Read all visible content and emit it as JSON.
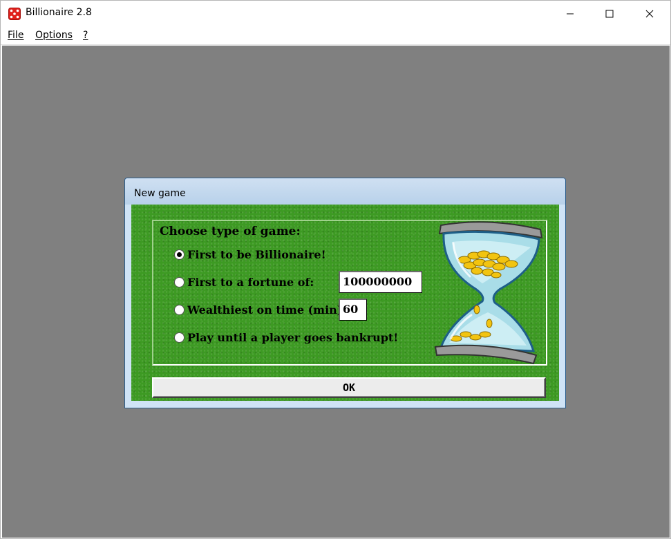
{
  "window": {
    "title": "Billionaire 2.8",
    "icon": "red-dice-icon",
    "controls": [
      "minimize-icon",
      "maximize-icon",
      "close-icon"
    ]
  },
  "menu": {
    "items": [
      {
        "label": "File"
      },
      {
        "label": "Options"
      },
      {
        "label": "?"
      }
    ]
  },
  "dialog": {
    "title": "New game",
    "group_label": "Choose type of game:",
    "options": [
      {
        "label": "First to be Billionaire!",
        "checked": true
      },
      {
        "label": "First to a fortune of:",
        "checked": false,
        "input_value": "100000000"
      },
      {
        "label": "Wealthiest on time (min):",
        "checked": false,
        "input_value": "60"
      },
      {
        "label": "Play until a player goes bankrupt!",
        "checked": false
      }
    ],
    "ok_label": "OK",
    "illustration": "hourglass-with-coins-icon"
  },
  "colors": {
    "client_bg": "#808080",
    "dialog_green": "#3d9a23",
    "dialog_frame": "#cfe3f6"
  }
}
